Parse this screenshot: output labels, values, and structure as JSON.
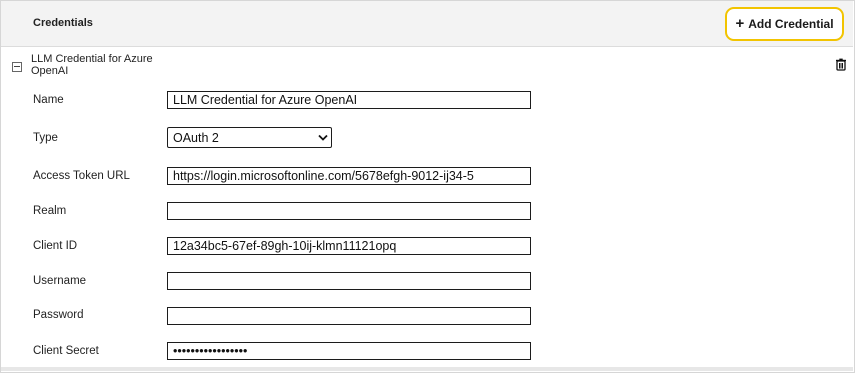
{
  "header": {
    "title": "Credentials",
    "add_button": "Add Credential"
  },
  "credential": {
    "title": "LLM Credential for Azure OpenAI",
    "fields": {
      "name": {
        "label": "Name",
        "value": "LLM Credential for Azure OpenAI"
      },
      "type": {
        "label": "Type",
        "value": "OAuth 2"
      },
      "access_token_url": {
        "label": "Access Token URL",
        "value": "https://login.microsoftonline.com/5678efgh-9012-ij34-5"
      },
      "realm": {
        "label": "Realm",
        "value": ""
      },
      "client_id": {
        "label": "Client ID",
        "value": "12a34bc5-67ef-89gh-10ij-klmn11121opq"
      },
      "username": {
        "label": "Username",
        "value": ""
      },
      "password": {
        "label": "Password",
        "value": ""
      },
      "client_secret": {
        "label": "Client Secret",
        "value": "•••••••••••••••••"
      }
    }
  },
  "icons": {
    "add": "plus-icon",
    "collapse": "minus-box-icon",
    "delete": "trash-icon",
    "dropdown": "chevron-down-icon"
  },
  "colors": {
    "accent_border": "#f2c400",
    "header_bg": "#f3f3f3"
  }
}
